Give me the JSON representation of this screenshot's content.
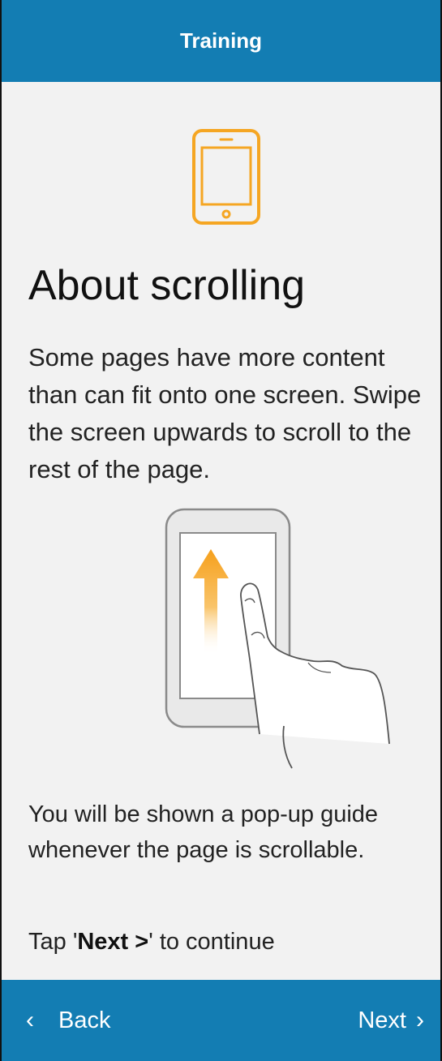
{
  "header": {
    "title": "Training"
  },
  "content": {
    "title": "About scrolling",
    "intro": "Some pages have more content than can fit onto one screen. Swipe the screen upwards to scroll to the rest of the page.",
    "info": "You will be shown a pop-up guide whenever the page is scrollable.",
    "instruction_prefix": "Tap '",
    "instruction_bold": "Next >",
    "instruction_suffix": "' to continue"
  },
  "footer": {
    "back_label": "Back",
    "next_label": "Next"
  },
  "icons": {
    "hero": "smartphone-icon",
    "illustration": "swipe-up-gesture-illustration",
    "back": "chevron-left-icon",
    "next": "chevron-right-icon"
  },
  "colors": {
    "header_bg": "#137db3",
    "footer_bg": "#137db3",
    "page_bg": "#f2f2f2",
    "accent_orange": "#f5a623"
  }
}
